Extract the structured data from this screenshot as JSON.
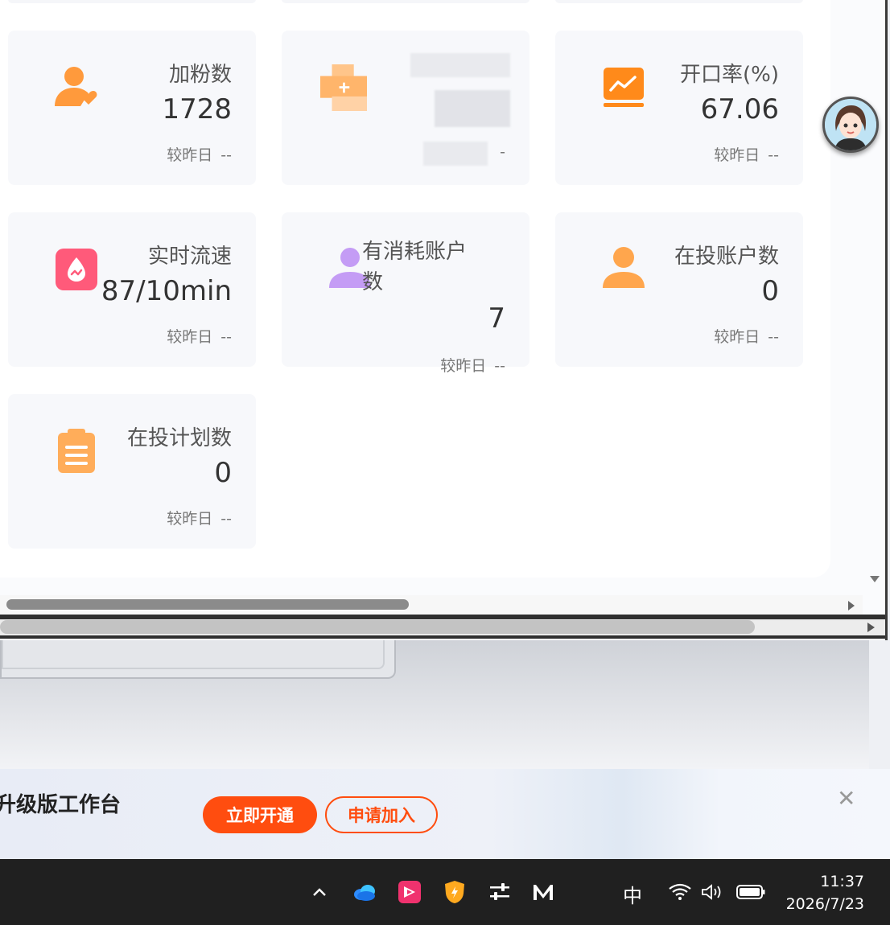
{
  "cards": [
    {
      "title": "加粉数",
      "value": "1728",
      "compare_label": "较昨日",
      "compare_value": "--",
      "icon": "user-heart-icon",
      "color": "#ff9a3c"
    },
    {
      "title": "",
      "value": "",
      "compare_label": "",
      "compare_value": "-",
      "icon": "blurred-add-icon",
      "color": "#ffb56b"
    },
    {
      "title": "开口率(%)",
      "value": "67.06",
      "compare_label": "较昨日",
      "compare_value": "--",
      "icon": "trend-chart-icon",
      "color": "#ff8a1a"
    },
    {
      "title": "实时流速",
      "value": "87/10min",
      "compare_label": "较昨日",
      "compare_value": "--",
      "icon": "flow-drop-icon",
      "color": "#ff5a7a"
    },
    {
      "title": "有消耗账户数",
      "value": "7",
      "compare_label": "较昨日",
      "compare_value": "--",
      "icon": "user-purple-icon",
      "color": "#c49cf5"
    },
    {
      "title": "在投账户数",
      "value": "0",
      "compare_label": "较昨日",
      "compare_value": "--",
      "icon": "user-orange-icon",
      "color": "#ffa64d"
    },
    {
      "title": "在投计划数",
      "value": "0",
      "compare_label": "较昨日",
      "compare_value": "--",
      "icon": "clipboard-icon",
      "color": "#ffad5a"
    }
  ],
  "promo": {
    "text": "升级版工作台",
    "primary_button": "立即开通",
    "secondary_button": "申请加入",
    "close": "✕"
  },
  "taskbar": {
    "ime": "中",
    "time": "11:37",
    "date": "2026/7/23"
  }
}
